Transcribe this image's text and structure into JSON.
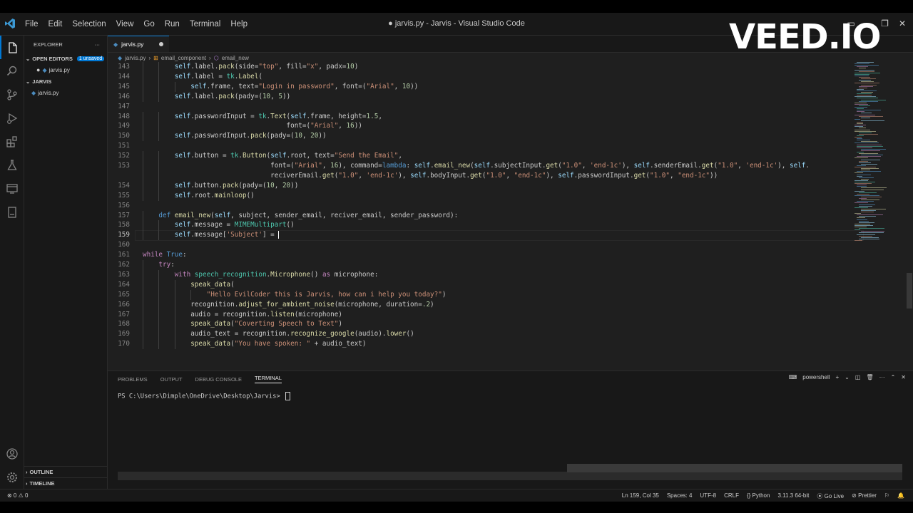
{
  "window": {
    "title": "● jarvis.py - Jarvis - Visual Studio Code"
  },
  "menu": [
    "File",
    "Edit",
    "Selection",
    "View",
    "Go",
    "Run",
    "Terminal",
    "Help"
  ],
  "activity_icons": [
    "files-icon",
    "search-icon",
    "source-control-icon",
    "run-debug-icon",
    "extensions-icon",
    "testing-icon",
    "remote-explorer-icon",
    "bookmarks-icon"
  ],
  "activity_bottom_icons": [
    "account-icon",
    "manage-gear-icon"
  ],
  "sidebar": {
    "header": "EXPLORER",
    "more": "···",
    "open_editors": {
      "label": "OPEN EDITORS",
      "badge": "1 unsaved",
      "file": "jarvis.py"
    },
    "folder": {
      "label": "JARVIS",
      "file": "jarvis.py"
    },
    "outline": "OUTLINE",
    "timeline": "TIMELINE"
  },
  "tab": {
    "label": "jarvis.py"
  },
  "breadcrumb": [
    "jarvis.py",
    "email_component",
    "email_new"
  ],
  "editor": {
    "current_line": 159,
    "lines": [
      {
        "n": "143",
        "indent": 2,
        "t": "self.label.pack(side=\"top\", fill=\"x\", padx=10)"
      },
      {
        "n": "144",
        "indent": 2,
        "t": "self.label = tk.Label("
      },
      {
        "n": "145",
        "indent": 3,
        "t": "self.frame, text=\"Login in password\", font=(\"Arial\", 10))"
      },
      {
        "n": "146",
        "indent": 2,
        "t": "self.label.pack(pady=(10, 5))"
      },
      {
        "n": "147",
        "indent": 0,
        "t": ""
      },
      {
        "n": "148",
        "indent": 2,
        "t": "self.passwordInput = tk.Text(self.frame, height=1.5,"
      },
      {
        "n": "149",
        "indent": 2,
        "t": "                            font=(\"Arial\", 16))"
      },
      {
        "n": "150",
        "indent": 2,
        "t": "self.passwordInput.pack(pady=(10, 20))"
      },
      {
        "n": "151",
        "indent": 0,
        "t": ""
      },
      {
        "n": "152",
        "indent": 2,
        "t": "self.button = tk.Button(self.root, text=\"Send the Email\","
      },
      {
        "n": "153",
        "indent": 2,
        "t": "                        font=(\"Arial\", 16), command=lambda: self.email_new(self.subjectInput.get(\"1.0\", 'end-1c'), self.senderEmail.get(\"1.0\", 'end-1c'), self."
      },
      {
        "n": "",
        "indent": 2,
        "t": "                        reciverEmail.get(\"1.0\", 'end-1c'), self.bodyInput.get(\"1.0\", \"end-1c\"), self.passwordInput.get(\"1.0\", \"end-1c\"))"
      },
      {
        "n": "154",
        "indent": 2,
        "t": "self.button.pack(pady=(10, 20))"
      },
      {
        "n": "155",
        "indent": 2,
        "t": "self.root.mainloop()"
      },
      {
        "n": "156",
        "indent": 0,
        "t": ""
      },
      {
        "n": "157",
        "indent": 1,
        "t": "def email_new(self, subject, sender_email, reciver_email, sender_password):"
      },
      {
        "n": "158",
        "indent": 2,
        "t": "self.message = MIMEMultipart()"
      },
      {
        "n": "159",
        "indent": 2,
        "t": "self.message['Subject'] = "
      },
      {
        "n": "160",
        "indent": 0,
        "t": ""
      },
      {
        "n": "161",
        "indent": 0,
        "t": "while True:"
      },
      {
        "n": "162",
        "indent": 1,
        "t": "try:"
      },
      {
        "n": "163",
        "indent": 2,
        "t": "with speech_recognition.Microphone() as microphone:"
      },
      {
        "n": "164",
        "indent": 3,
        "t": "speak_data("
      },
      {
        "n": "165",
        "indent": 4,
        "t": "\"Hello EvilCoder this is Jarvis, how can i help you today?\")"
      },
      {
        "n": "166",
        "indent": 3,
        "t": "recognition.adjust_for_ambient_noise(microphone, duration=.2)"
      },
      {
        "n": "167",
        "indent": 3,
        "t": "audio = recognition.listen(microphone)"
      },
      {
        "n": "168",
        "indent": 3,
        "t": "speak_data(\"Coverting Speech to Text\")"
      },
      {
        "n": "169",
        "indent": 3,
        "t": "audio_text = recognition.recognize_google(audio).lower()"
      },
      {
        "n": "170",
        "indent": 3,
        "t": "speak_data(\"You have spoken: \" + audio_text)"
      }
    ]
  },
  "panel": {
    "tabs": [
      "PROBLEMS",
      "OUTPUT",
      "DEBUG CONSOLE",
      "TERMINAL"
    ],
    "active_tab": "TERMINAL",
    "shell": "powershell",
    "prompt": "PS C:\\Users\\Dimple\\OneDrive\\Desktop\\Jarvis> "
  },
  "status": {
    "problems": "⊗ 0 ⚠ 0",
    "items": [
      "Ln 159, Col 35",
      "Spaces: 4",
      "UTF-8",
      "CRLF",
      "{} Python",
      "3.11.3 64-bit",
      "⦿ Go Live",
      "⊘ Prettier"
    ]
  },
  "watermark": "VEED.IO",
  "colors": {
    "accent": "#0078d4",
    "background": "#1f1f1f",
    "keyword": "#569cd6",
    "string": "#ce9178",
    "function": "#dcdcaa",
    "class": "#4ec9b0"
  }
}
